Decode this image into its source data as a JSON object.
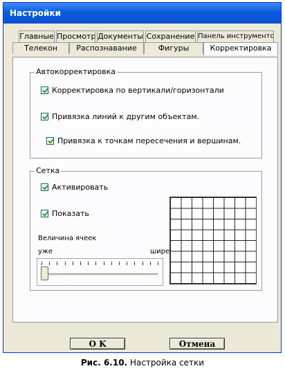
{
  "window": {
    "title": "Настройки"
  },
  "tabs": {
    "row_back": [
      "Главные",
      "Просмотр",
      "Документы",
      "Сохранение",
      "Панель инструментов"
    ],
    "row_front": [
      "Телекон",
      "Распознавание",
      "Фигуры",
      "Корректировка"
    ],
    "active": "Корректировка"
  },
  "autocorrect": {
    "legend": "Автокорректировка",
    "options": [
      {
        "label": "Корректировка по вертикали/горизонтали",
        "checked": true
      },
      {
        "label": "Привязка линий к другим объектам.",
        "checked": true
      },
      {
        "label": "Привязка к точкам пересечения и вершинам.",
        "checked": true
      }
    ]
  },
  "grid": {
    "legend": "Сетка",
    "activate": {
      "label": "Активировать",
      "checked": true
    },
    "show": {
      "label": "Показать",
      "checked": true
    },
    "cell_size_label": "Величина ячеек",
    "narrow_label": "уже",
    "wide_label": "шире",
    "slider_value_fraction": 0.0
  },
  "buttons": {
    "ok": "O K",
    "cancel": "Отмена"
  },
  "caption": {
    "prefix": "Рис. 6.10.",
    "text": "Настройка сетки"
  }
}
